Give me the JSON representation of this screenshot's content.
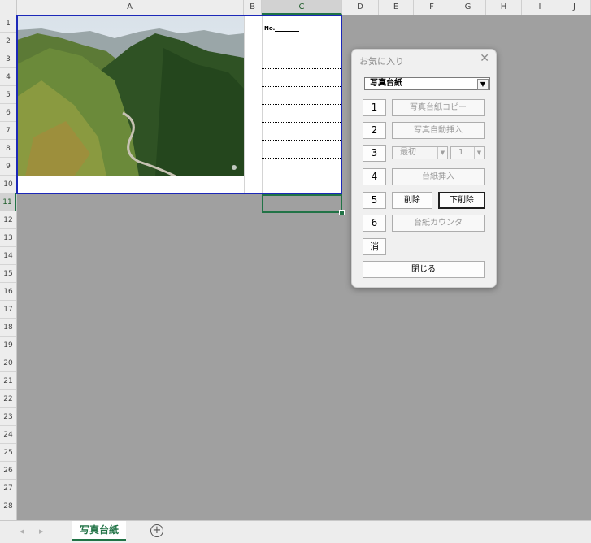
{
  "columns": [
    "A",
    "B",
    "C",
    "D",
    "E",
    "F",
    "G",
    "H",
    "I",
    "J"
  ],
  "rows": [
    "1",
    "2",
    "3",
    "4",
    "5",
    "6",
    "7",
    "8",
    "9",
    "10",
    "11",
    "12",
    "13",
    "14",
    "15",
    "16",
    "17",
    "18",
    "19",
    "20",
    "21",
    "22",
    "23",
    "24",
    "25",
    "26",
    "27",
    "28"
  ],
  "selected_column": "C",
  "selected_row": "11",
  "sheet": {
    "no_label": "No.",
    "tabs": [
      "写真台紙"
    ],
    "add_sheet_icon": "plus-circle-icon",
    "active_tab_color": "#217346",
    "print_area_color": "#1c28b8"
  },
  "dialog": {
    "title": "お気に入り",
    "close_icon": "close-icon",
    "combo_value": "写真台紙",
    "buttons": {
      "b1": "1",
      "copy": "写真台紙コピー",
      "b2": "2",
      "auto_insert": "写真自動挿入",
      "b3": "3",
      "start_value": "最初",
      "count_value": "1",
      "b4": "4",
      "sheet_insert": "台紙挿入",
      "b5": "5",
      "delete": "削除",
      "delete_below": "下削除",
      "b6": "6",
      "counter": "台紙カウンタ",
      "clear": "消",
      "close": "閉じる"
    }
  }
}
